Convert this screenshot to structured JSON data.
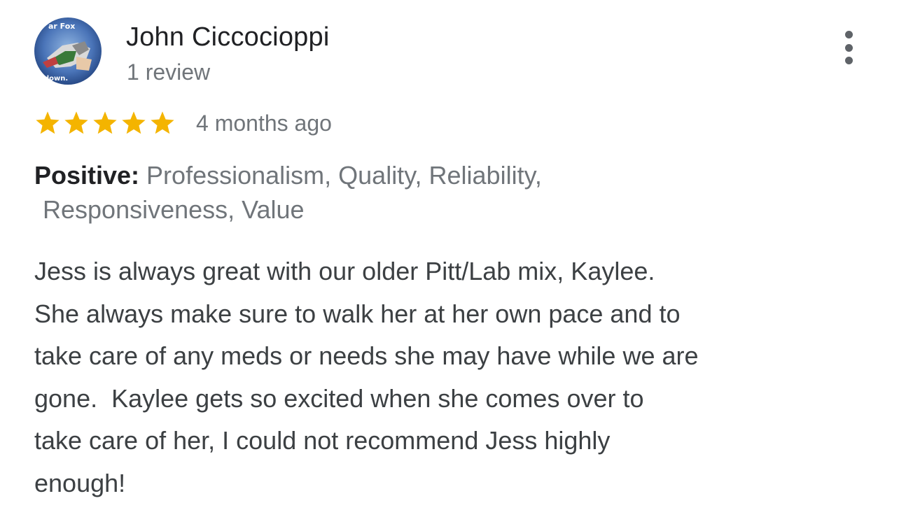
{
  "reviewer": {
    "name": "John Ciccocioppi",
    "review_count": "1 review",
    "avatar_icon": "reviewer-avatar-photo",
    "avatar_text_top": "ar Fox",
    "avatar_text_bottom": "down."
  },
  "menu": {
    "icon": "more-vert-icon"
  },
  "rating": {
    "stars": 5,
    "max_stars": 5,
    "star_color": "#f4b400",
    "time_ago": "4 months ago"
  },
  "attributes": {
    "label": "Positive:",
    "values_line1": " Professionalism, Quality, Reliability,",
    "values_line2": "Responsiveness, Value"
  },
  "review": {
    "lines": [
      "Jess is always great with our older Pitt/Lab mix, Kaylee.",
      "She always make sure to walk her at her own pace and to",
      "take care of any meds or needs she may have while we are",
      "gone.  Kaylee gets so excited when she comes over to",
      "take care of her, I could not recommend Jess highly",
      "enough!"
    ]
  }
}
